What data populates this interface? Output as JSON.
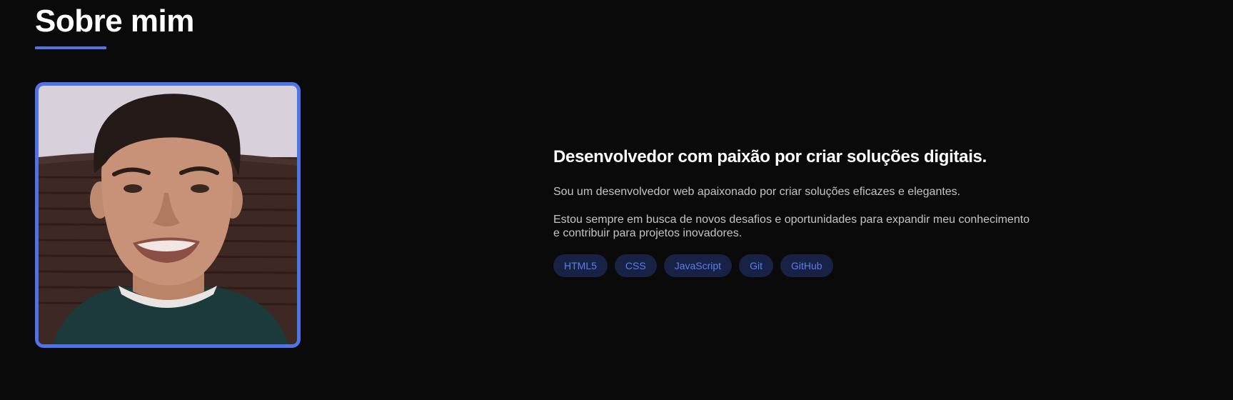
{
  "about": {
    "title": "Sobre mim",
    "headline": "Desenvolvedor com paixão por criar soluções digitais.",
    "paragraph_1": "Sou um desenvolvedor web apaixonado por criar soluções eficazes e elegantes.",
    "paragraph_2": "Estou sempre em busca de novos desafios e oportunidades para expandir meu conhecimento e contribuir para projetos inovadores.",
    "skills": [
      "HTML5",
      "CSS",
      "JavaScript",
      "Git",
      "GitHub"
    ]
  },
  "colors": {
    "background": "#0a0a0a",
    "accent": "#4f73e8",
    "tag_background": "#172245",
    "tag_text": "#5c7ef0",
    "body_text": "#c4c4c4"
  }
}
